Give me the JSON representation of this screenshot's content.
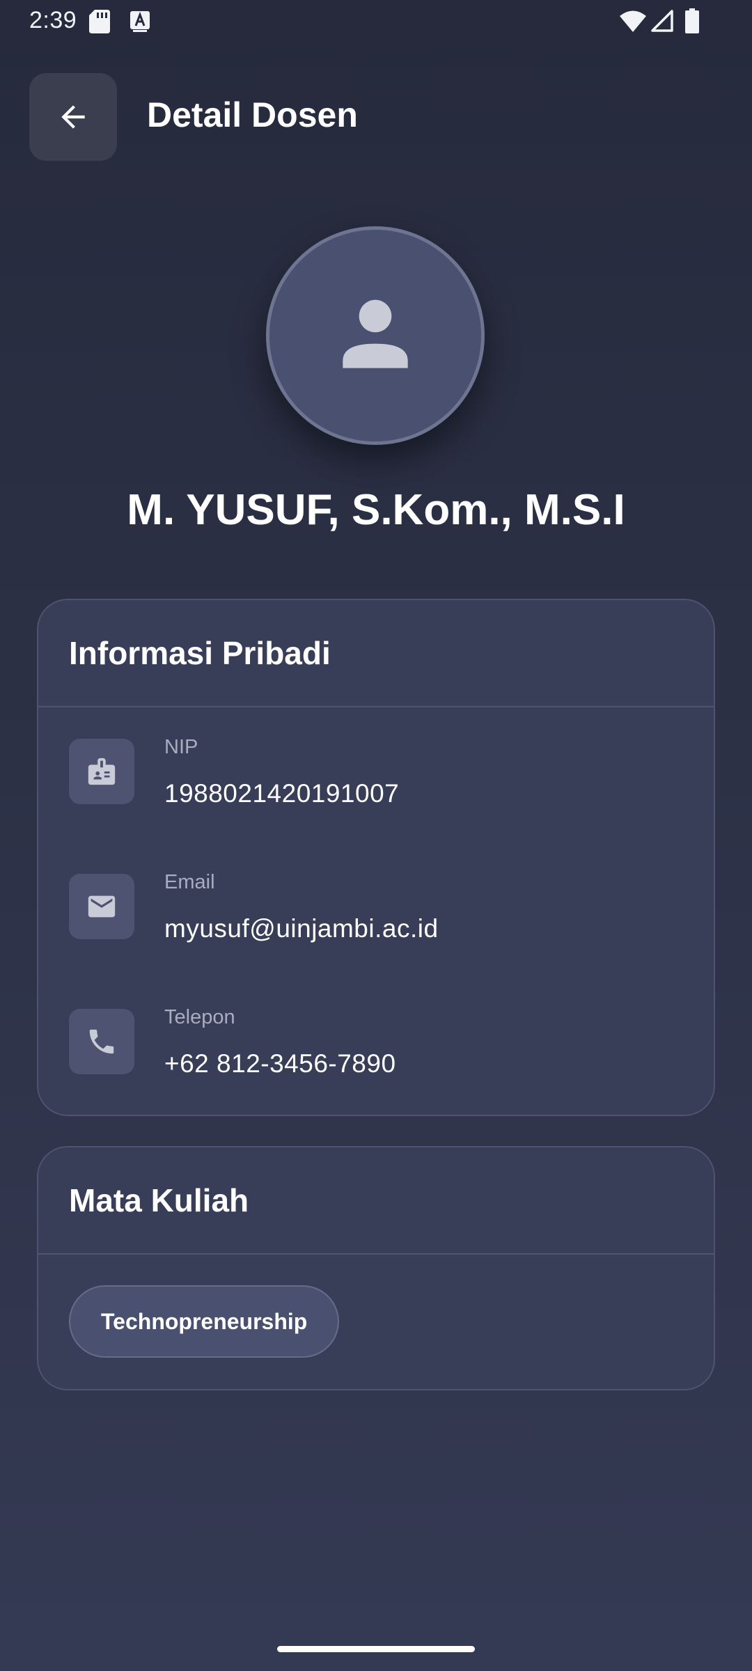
{
  "status_bar": {
    "time": "2:39",
    "icons": [
      "sd-card-icon",
      "keyboard-a-icon",
      "wifi-icon",
      "signal-icon",
      "battery-icon"
    ]
  },
  "app_bar": {
    "back_icon": "arrow-back-icon",
    "title": "Detail Dosen"
  },
  "profile": {
    "avatar_icon": "person-icon",
    "name": "M. YUSUF, S.Kom., M.S.I"
  },
  "personal_info": {
    "title": "Informasi Pribadi",
    "rows": [
      {
        "icon": "badge-icon",
        "label": "NIP",
        "value": "1988021420191007"
      },
      {
        "icon": "mail-icon",
        "label": "Email",
        "value": "myusuf@uinjambi.ac.id"
      },
      {
        "icon": "phone-icon",
        "label": "Telepon",
        "value": "+62 812-3456-7890"
      }
    ]
  },
  "courses": {
    "title": "Mata Kuliah",
    "items": [
      "Technopreneurship"
    ]
  },
  "colors": {
    "background_top": "#262a3c",
    "background_bottom": "#353a54",
    "card": "#393e58",
    "card_border": "#4d5370",
    "icon_box": "#4d5370",
    "avatar": "#4a5070",
    "label_text": "#a8adbf",
    "icon_fill": "#c9ccd6"
  }
}
